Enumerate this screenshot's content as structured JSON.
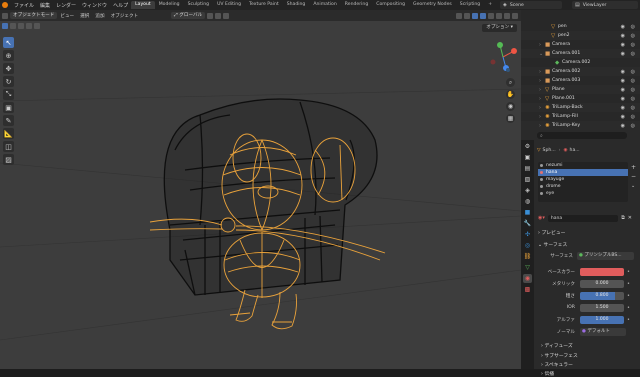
{
  "menubar": {
    "menus": [
      "ファイル",
      "編集",
      "レンダー",
      "ウィンドウ",
      "ヘルプ"
    ],
    "workspaces": [
      "Layout",
      "Modeling",
      "Sculpting",
      "UV Editing",
      "Texture Paint",
      "Shading",
      "Animation",
      "Rendering",
      "Compositing",
      "Geometry Nodes",
      "Scripting"
    ],
    "active_workspace": "Layout",
    "add_tab": "+",
    "scene_label": "Scene",
    "viewlayer_label": "ViewLayer"
  },
  "viewport": {
    "mode": "オブジェクトモード",
    "menus": [
      "ビュー",
      "選択",
      "追加",
      "オブジェクト"
    ],
    "transform": "グローバル",
    "options": "オプション",
    "tools": [
      "select",
      "cursor",
      "move",
      "rotate",
      "scale",
      "transform",
      "annotate",
      "measure",
      "add-cube",
      "shading"
    ],
    "colors": {
      "wire": "#e9a23b",
      "mesh": "#101010",
      "background": "#3d3d3d"
    }
  },
  "outliner": {
    "rows": [
      {
        "name": "pen",
        "type": "mesh",
        "indent": 3
      },
      {
        "name": "pen2",
        "type": "mesh",
        "indent": 3
      },
      {
        "name": "Camera",
        "type": "camera",
        "indent": 1
      },
      {
        "name": "Camera.001",
        "type": "camera",
        "indent": 1
      },
      {
        "name": "Camera.002",
        "type": "camera-data",
        "indent": 2
      },
      {
        "name": "Camera.002",
        "type": "camera",
        "indent": 1
      },
      {
        "name": "Camera.003",
        "type": "camera",
        "indent": 1
      },
      {
        "name": "Plane",
        "type": "mesh",
        "indent": 1
      },
      {
        "name": "Plane.001",
        "type": "mesh",
        "indent": 1
      },
      {
        "name": "TriLamp-Back",
        "type": "light",
        "indent": 1
      },
      {
        "name": "TriLamp-Fill",
        "type": "light",
        "indent": 1
      },
      {
        "name": "TriLamp-Key",
        "type": "light",
        "indent": 1
      }
    ]
  },
  "properties": {
    "search_placeholder": "",
    "breadcrumb": [
      "Sph...",
      "ha..."
    ],
    "material_slots": [
      {
        "name": "nezumi",
        "color": "#9a9a9a"
      },
      {
        "name": "hana",
        "color": "#e07070"
      },
      {
        "name": "mayuge",
        "color": "#9a9a9a"
      },
      {
        "name": "drome",
        "color": "#9a9a9a"
      },
      {
        "name": "eye",
        "color": "#9a9a9a"
      }
    ],
    "active_slot_index": 1,
    "material_name": "hana",
    "preview_label": "プレビュー",
    "surface_label": "サーフェス",
    "surface_field_label": "サーフェス",
    "surface_value": "プリンシプルBS...",
    "base_color_label": "ベースカラー",
    "base_color": "#e05d5d",
    "metallic_label": "メタリック",
    "metallic": "0.000",
    "roughness_label": "粗さ",
    "roughness": "0.800",
    "ior_label": "IOR",
    "ior": "1.500",
    "alpha_label": "アルファ",
    "alpha": "1.000",
    "normal_label": "ノーマル",
    "normal_value": "デフォルト",
    "sections": [
      "ディフューズ",
      "サブサーフェス",
      "スペキュラー",
      "伝播"
    ]
  }
}
